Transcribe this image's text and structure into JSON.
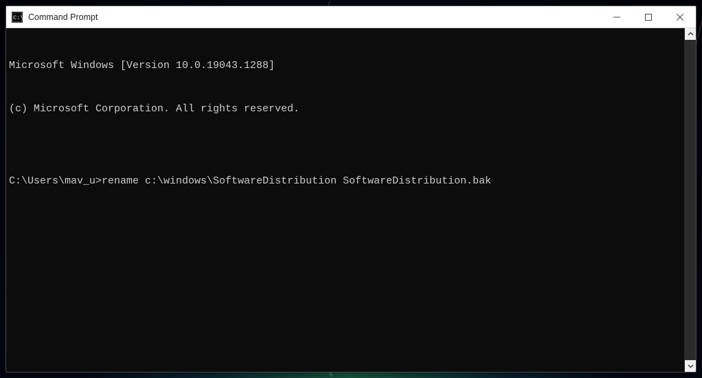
{
  "window": {
    "title": "Command Prompt"
  },
  "terminal": {
    "banner_line1": "Microsoft Windows [Version 10.0.19043.1288]",
    "banner_line2": "(c) Microsoft Corporation. All rights reserved.",
    "blank": "",
    "prompt": "C:\\Users\\mav_u>",
    "command": "rename c:\\windows\\SoftwareDistribution SoftwareDistribution.bak"
  }
}
